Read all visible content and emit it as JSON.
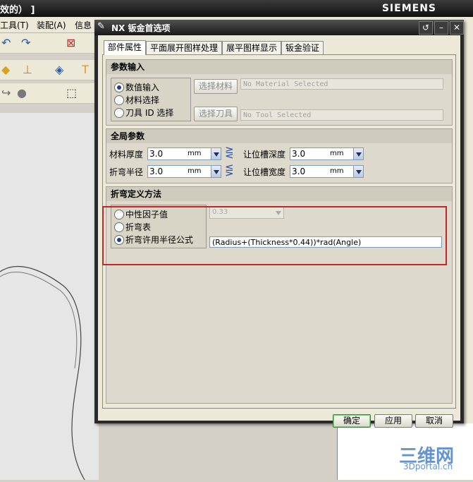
{
  "app": {
    "title_fragment": "效的） ]",
    "brand": "SIEMENS",
    "menu": [
      "工具(T)",
      "装配(A)",
      "信息"
    ]
  },
  "dialog": {
    "title": "NX 钣金首选项",
    "controls": {
      "reset": "↺",
      "minimize": "–",
      "close": "✕"
    },
    "tabs": [
      {
        "label": "部件属性",
        "active": true
      },
      {
        "label": "平面展开图样处理",
        "active": false
      },
      {
        "label": "展平图样显示",
        "active": false
      },
      {
        "label": "钣金验证",
        "active": false
      }
    ],
    "param_input": {
      "header": "参数输入",
      "options": [
        {
          "label": "数值输入",
          "selected": true
        },
        {
          "label": "材料选择",
          "selected": false
        },
        {
          "label": "刀具 ID 选择",
          "selected": false
        }
      ],
      "select_material_button": "选择材料",
      "select_tool_button": "选择刀具",
      "material_value": "No Material Selected",
      "tool_value": "No Tool Selected"
    },
    "global_params": {
      "header": "全局参数",
      "thickness_label": "材料厚度",
      "thickness_value": "3.0",
      "bend_radius_label": "折弯半径",
      "bend_radius_value": "3.0",
      "relief_depth_label": "让位槽深度",
      "relief_depth_value": "3.0",
      "relief_width_label": "让位槽宽度",
      "relief_width_value": "3.0",
      "unit": "mm"
    },
    "bend_method": {
      "header": "折弯定义方法",
      "options": [
        {
          "label": "中性因子值",
          "selected": false
        },
        {
          "label": "折弯表",
          "selected": false
        },
        {
          "label": "折弯许用半径公式",
          "selected": true
        }
      ],
      "neutral_factor_value": "0.33",
      "formula": "(Radius+(Thickness*0.44))*rad(Angle)"
    },
    "buttons": {
      "ok": "确定",
      "apply": "应用",
      "cancel": "取消"
    }
  },
  "watermark": {
    "main": "三维网",
    "sub": "3Dportal.cn"
  },
  "colors": {
    "highlight": "#c2262a",
    "title_bar": "#1a1a1a",
    "accent": "#1a3e96"
  }
}
